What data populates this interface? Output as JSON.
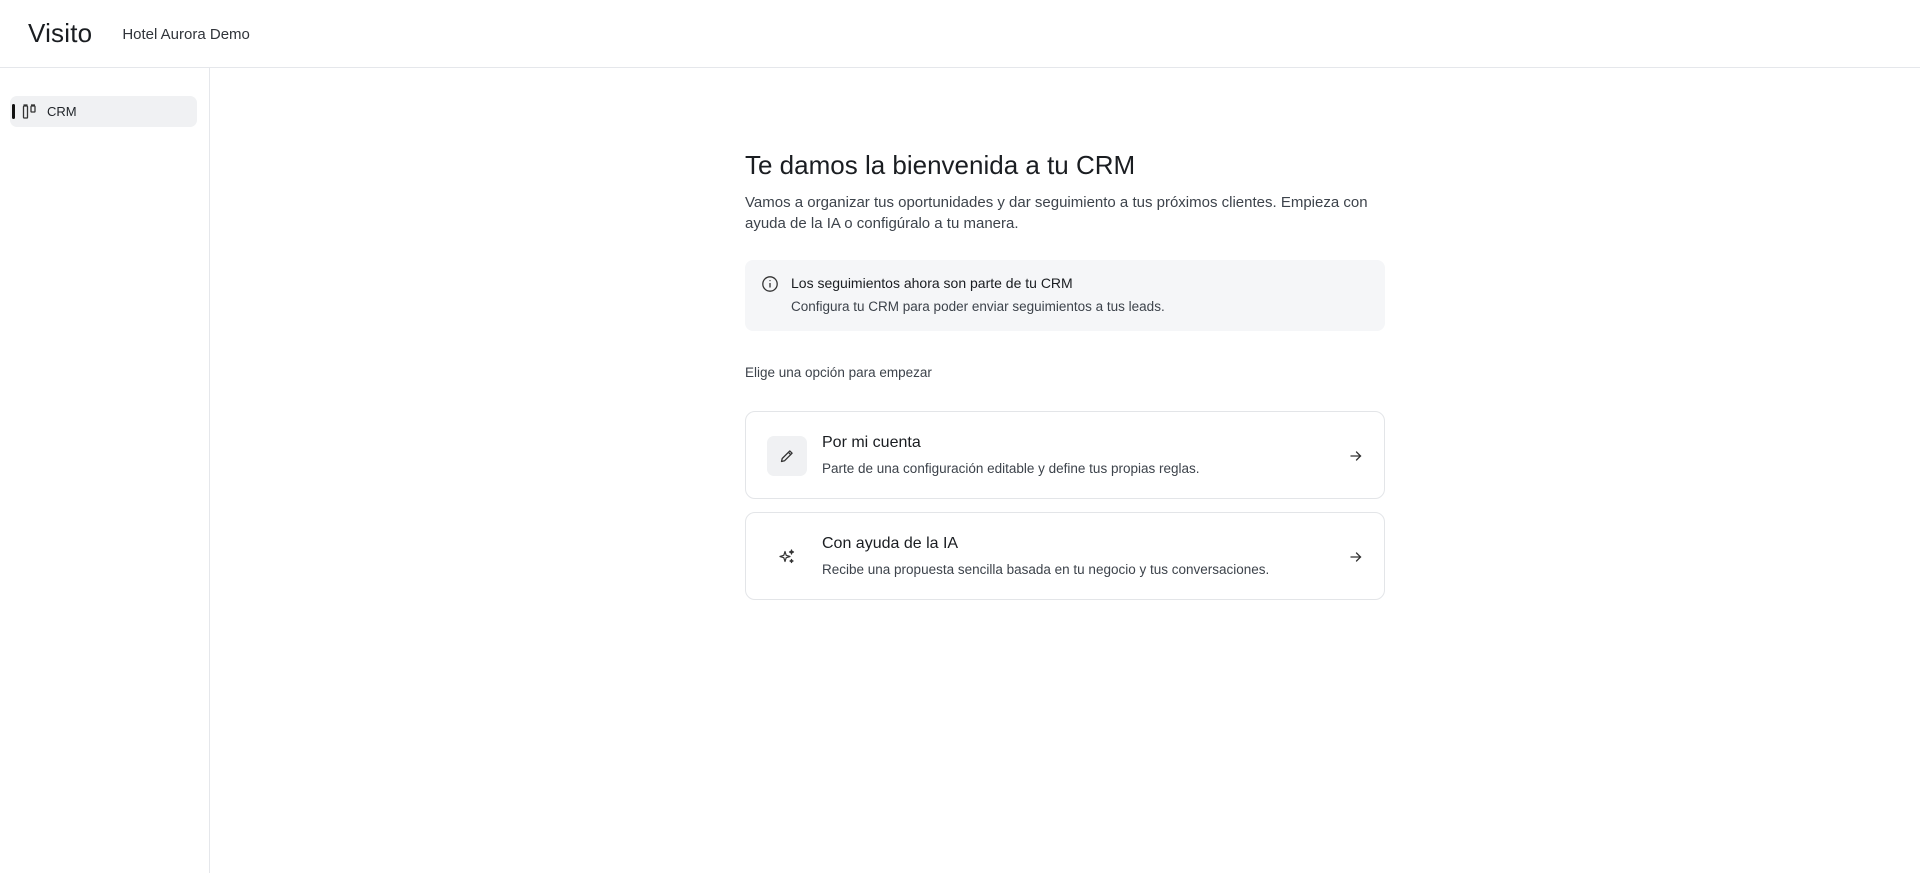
{
  "header": {
    "brand": "Visito",
    "workspace": "Hotel Aurora Demo"
  },
  "sidebar": {
    "items": [
      {
        "label": "CRM",
        "icon": "kanban-icon",
        "active": true
      }
    ]
  },
  "main": {
    "title": "Te damos la bienvenida a tu CRM",
    "subtitle": "Vamos a organizar tus oportunidades y dar seguimiento a tus próximos clientes. Empieza con ayuda de la IA o configúralo a tu manera.",
    "notice": {
      "icon": "info-icon",
      "title": "Los seguimientos ahora son parte de tu CRM",
      "text": "Configura tu CRM para poder enviar seguimientos a tus leads."
    },
    "choose_label": "Elige una opción para empezar",
    "options": [
      {
        "icon": "pencil-icon",
        "title": "Por mi cuenta",
        "description": "Parte de una configuración editable y define tus propias reglas."
      },
      {
        "icon": "sparkles-icon",
        "title": "Con ayuda de la IA",
        "description": "Recibe una propuesta sencilla basada en tu negocio y tus conversaciones."
      }
    ]
  }
}
